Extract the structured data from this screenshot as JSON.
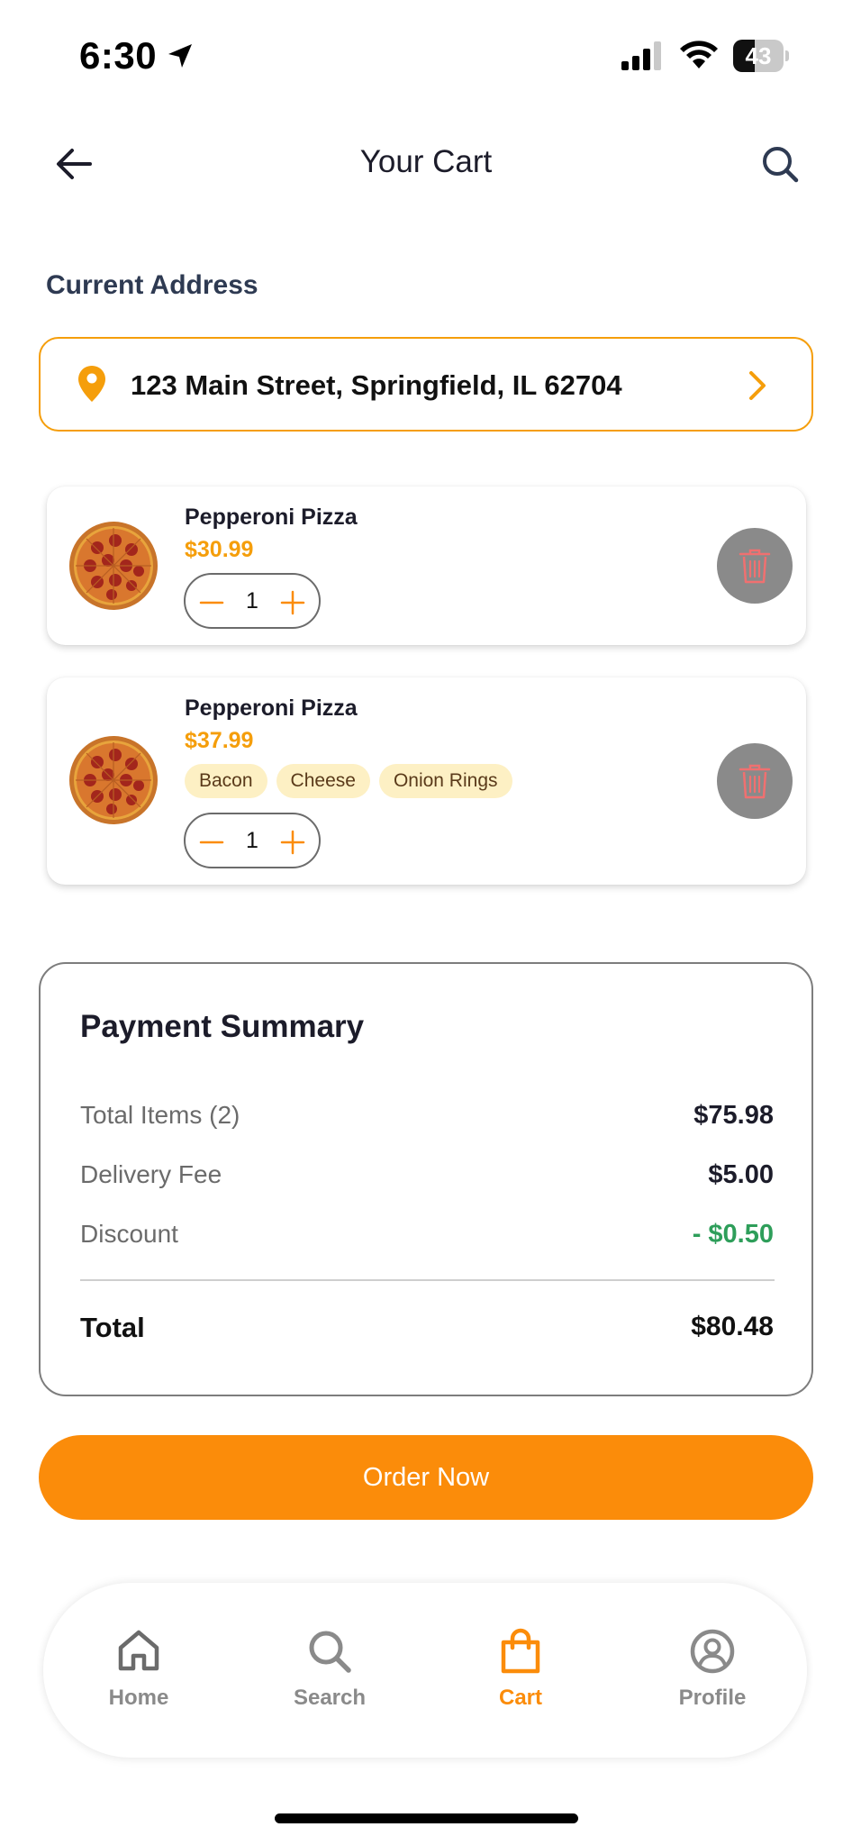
{
  "status_bar": {
    "time": "6:30",
    "battery": "43"
  },
  "header": {
    "title": "Your Cart"
  },
  "address": {
    "label": "Current Address",
    "text": "123 Main Street, Springfield, IL 62704"
  },
  "cart": {
    "items": [
      {
        "name": "Pepperoni Pizza",
        "price": "$30.99",
        "quantity": "1",
        "addons": []
      },
      {
        "name": "Pepperoni Pizza",
        "price": "$37.99",
        "quantity": "1",
        "addons": [
          "Bacon",
          "Cheese",
          "Onion Rings"
        ]
      }
    ]
  },
  "summary": {
    "title": "Payment Summary",
    "total_items_label": "Total Items (2)",
    "total_items_value": "$75.98",
    "delivery_label": "Delivery Fee",
    "delivery_value": "$5.00",
    "discount_label": "Discount",
    "discount_value": "- $0.50",
    "total_label": "Total",
    "total_value": "$80.48"
  },
  "order_button": "Order Now",
  "nav": {
    "home": "Home",
    "search": "Search",
    "cart": "Cart",
    "profile": "Profile",
    "active": "cart"
  },
  "colors": {
    "accent": "#fb8c0a",
    "price": "#f59e0b",
    "discount": "#2e9e5a",
    "tag_bg": "#fdf0c4"
  }
}
